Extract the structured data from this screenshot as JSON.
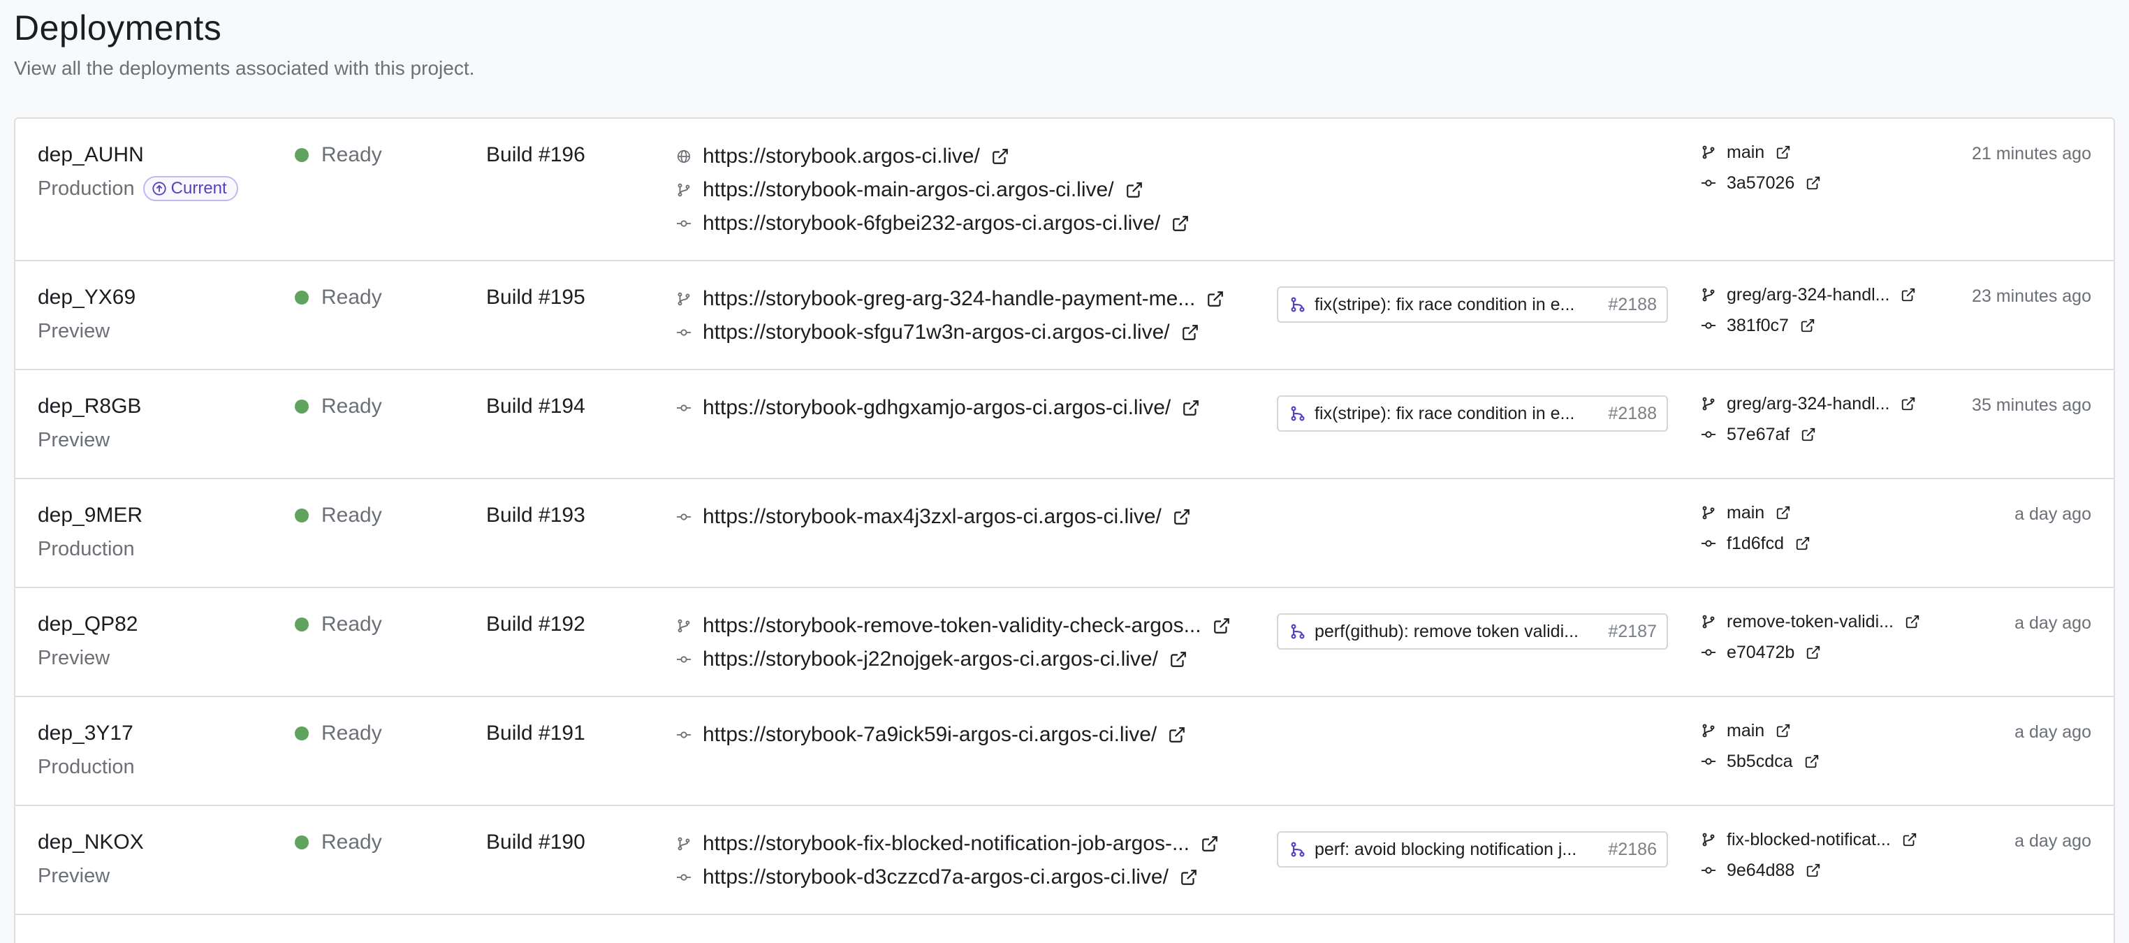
{
  "header": {
    "title": "Deployments",
    "subtitle": "View all the deployments associated with this project."
  },
  "current_badge": "Current",
  "deployments": [
    {
      "id": "dep_AUHN",
      "environment": "Production",
      "current": true,
      "status": "Ready",
      "build": "Build #196",
      "urls": [
        {
          "kind": "globe-icon",
          "text": "https://storybook.argos-ci.live/"
        },
        {
          "kind": "branch-icon",
          "text": "https://storybook-main-argos-ci.argos-ci.live/"
        },
        {
          "kind": "commit-icon",
          "text": "https://storybook-6fgbei232-argos-ci.argos-ci.live/"
        }
      ],
      "pr": null,
      "branch": "main",
      "commit": "3a57026",
      "time": "21 minutes ago"
    },
    {
      "id": "dep_YX69",
      "environment": "Preview",
      "current": false,
      "status": "Ready",
      "build": "Build #195",
      "urls": [
        {
          "kind": "branch-icon",
          "text": "https://storybook-greg-arg-324-handle-payment-me..."
        },
        {
          "kind": "commit-icon",
          "text": "https://storybook-sfgu71w3n-argos-ci.argos-ci.live/"
        }
      ],
      "pr": {
        "title": "fix(stripe): fix race condition in e...",
        "number": "#2188"
      },
      "branch": "greg/arg-324-handl...",
      "commit": "381f0c7",
      "time": "23 minutes ago"
    },
    {
      "id": "dep_R8GB",
      "environment": "Preview",
      "current": false,
      "status": "Ready",
      "build": "Build #194",
      "urls": [
        {
          "kind": "commit-icon",
          "text": "https://storybook-gdhgxamjo-argos-ci.argos-ci.live/"
        }
      ],
      "pr": {
        "title": "fix(stripe): fix race condition in e...",
        "number": "#2188"
      },
      "branch": "greg/arg-324-handl...",
      "commit": "57e67af",
      "time": "35 minutes ago"
    },
    {
      "id": "dep_9MER",
      "environment": "Production",
      "current": false,
      "status": "Ready",
      "build": "Build #193",
      "urls": [
        {
          "kind": "commit-icon",
          "text": "https://storybook-max4j3zxl-argos-ci.argos-ci.live/"
        }
      ],
      "pr": null,
      "branch": "main",
      "commit": "f1d6fcd",
      "time": "a day ago"
    },
    {
      "id": "dep_QP82",
      "environment": "Preview",
      "current": false,
      "status": "Ready",
      "build": "Build #192",
      "urls": [
        {
          "kind": "branch-icon",
          "text": "https://storybook-remove-token-validity-check-argos..."
        },
        {
          "kind": "commit-icon",
          "text": "https://storybook-j22nojgek-argos-ci.argos-ci.live/"
        }
      ],
      "pr": {
        "title": "perf(github): remove token validi...",
        "number": "#2187"
      },
      "branch": "remove-token-validi...",
      "commit": "e70472b",
      "time": "a day ago"
    },
    {
      "id": "dep_3Y17",
      "environment": "Production",
      "current": false,
      "status": "Ready",
      "build": "Build #191",
      "urls": [
        {
          "kind": "commit-icon",
          "text": "https://storybook-7a9ick59i-argos-ci.argos-ci.live/"
        }
      ],
      "pr": null,
      "branch": "main",
      "commit": "5b5cdca",
      "time": "a day ago"
    },
    {
      "id": "dep_NKOX",
      "environment": "Preview",
      "current": false,
      "status": "Ready",
      "build": "Build #190",
      "urls": [
        {
          "kind": "branch-icon",
          "text": "https://storybook-fix-blocked-notification-job-argos-..."
        },
        {
          "kind": "commit-icon",
          "text": "https://storybook-d3czzcd7a-argos-ci.argos-ci.live/"
        }
      ],
      "pr": {
        "title": "perf: avoid blocking notification j...",
        "number": "#2186"
      },
      "branch": "fix-blocked-notificat...",
      "commit": "9e64d88",
      "time": "a day ago"
    }
  ],
  "colors": {
    "status_ready": "#5fa35f",
    "badge_accent": "#5a3ec2",
    "pr_icon": "#5a3ec2",
    "border": "#dcdee2",
    "muted_text": "#6b6f76"
  }
}
